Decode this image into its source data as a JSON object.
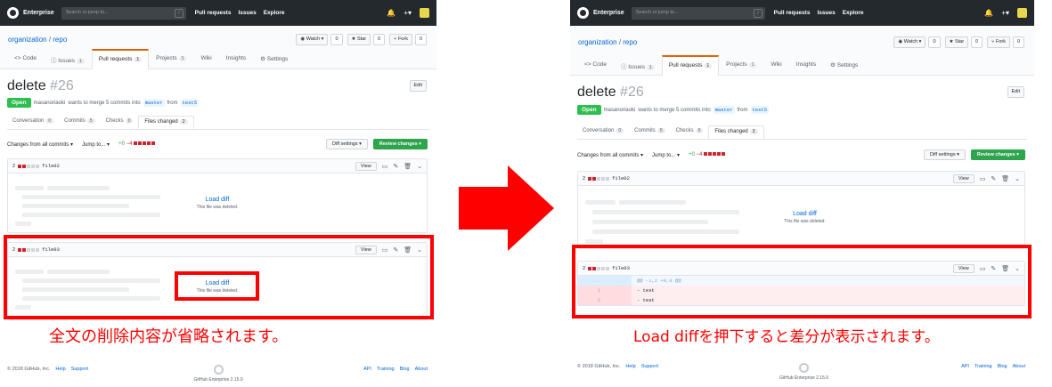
{
  "header": {
    "enterprise": "Enterprise",
    "search_placeholder": "Search or jump to...",
    "slash": "/",
    "nav": [
      "Pull requests",
      "Issues",
      "Explore"
    ],
    "bell": "🔔",
    "plus": "+▾"
  },
  "repo": {
    "owner": "organization",
    "sep": " / ",
    "name": "repo",
    "watch": "◉ Watch ▾",
    "watch_count": "0",
    "star": "★ Star",
    "star_count": "0",
    "fork": "⑂ Fork",
    "fork_count": "0",
    "tabs": [
      {
        "label": "<> Code"
      },
      {
        "label": "ⓘ Issues",
        "count": "1"
      },
      {
        "label": "Pull requests",
        "count": "1"
      },
      {
        "label": "Projects",
        "count": "1"
      },
      {
        "label": "Wiki"
      },
      {
        "label": "Insights"
      },
      {
        "label": "⚙ Settings"
      }
    ]
  },
  "pr": {
    "title": "delete",
    "number": "#26",
    "edit": "Edit",
    "status": "Open",
    "author": "masanoriaoki",
    "meta_text": "wants to merge 5 commits into",
    "base": "master",
    "from": "from",
    "head": "test5",
    "tabs": [
      {
        "label": "Conversation",
        "count": "0"
      },
      {
        "label": "Commits",
        "count": "5"
      },
      {
        "label": "Checks",
        "count": "0"
      },
      {
        "label": "Files changed",
        "count": "2"
      }
    ]
  },
  "toolbar": {
    "changes_from": "Changes from all commits ▾",
    "jump_to": "Jump to... ▾",
    "additions": "+0",
    "deletions": "−4",
    "diff_settings": "Diff settings ▾",
    "review_changes": "Review changes ▾"
  },
  "files": [
    {
      "count": "2",
      "name": "file02",
      "view": "View",
      "load_diff": "Load diff",
      "deleted_msg": "This file was deleted."
    },
    {
      "count": "2",
      "name": "file03",
      "view": "View",
      "load_diff": "Load diff",
      "deleted_msg": "This file was deleted."
    }
  ],
  "diff": {
    "hunk_left": "...",
    "hunk_right": "...",
    "hunk": "@@ -1,2 +0,0 @@",
    "lines": [
      {
        "num": "1",
        "text": "- test"
      },
      {
        "num": "2",
        "text": "- test"
      }
    ]
  },
  "footer": {
    "copyright": "© 2018 GitHub, Inc.",
    "left_links": [
      "Help",
      "Support"
    ],
    "right_links": [
      "API",
      "Training",
      "Blog",
      "About"
    ],
    "version": "GitHub Enterprise 2.15.0"
  },
  "annotations": {
    "left_caption": "全文の削除内容が省略されます。",
    "right_caption": "Load diffを押下すると差分が表示されます。",
    "highlight_color": "#ff0000"
  }
}
